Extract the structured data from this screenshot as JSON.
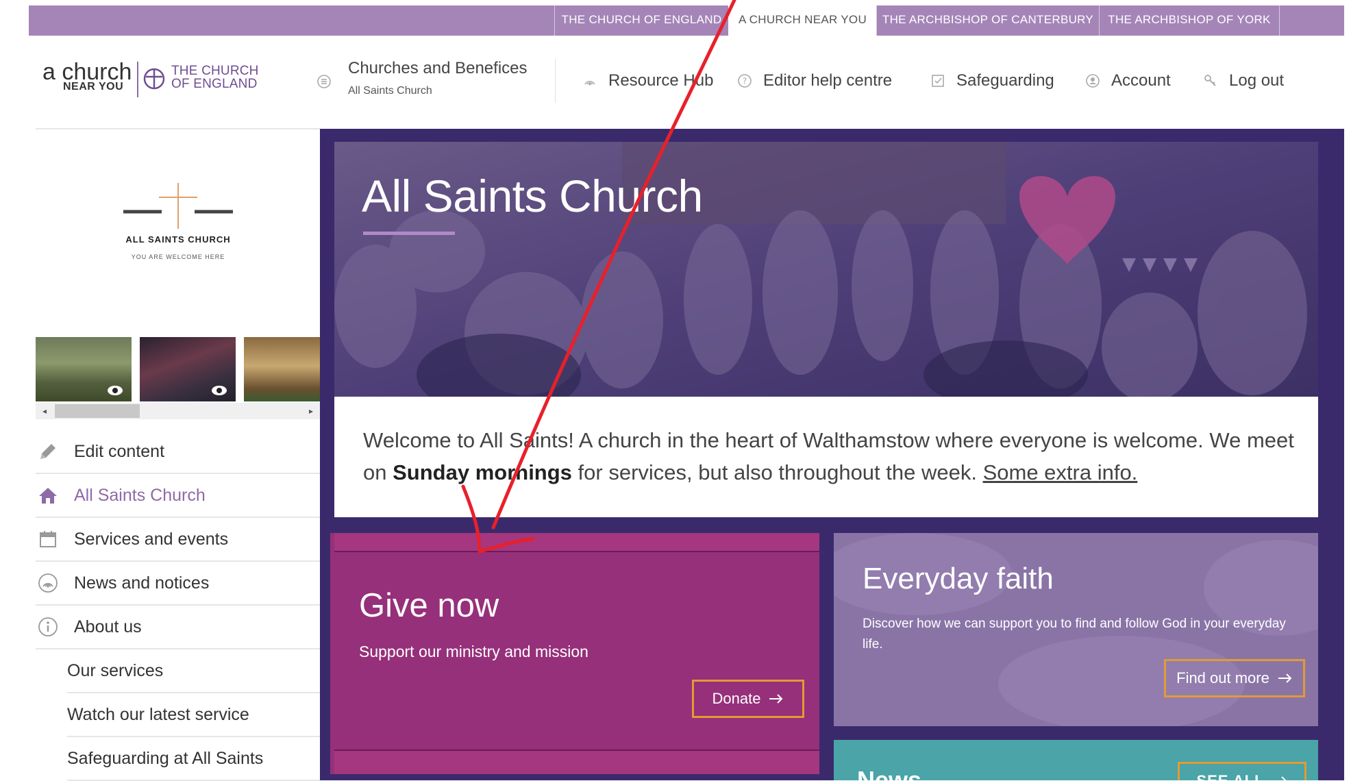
{
  "topbar": {
    "tabs": [
      {
        "label": "The Church of England",
        "active": false
      },
      {
        "label": "A Church Near You",
        "active": true
      },
      {
        "label": "The Archbishop of Canterbury",
        "active": false
      },
      {
        "label": "The Archbishop of York",
        "active": false
      }
    ]
  },
  "logo": {
    "brand_line1": "a church",
    "brand_line2": "NEAR YOU",
    "coe_line1": "THE CHURCH",
    "coe_line2": "OF ENGLAND"
  },
  "header": {
    "churches": {
      "label": "Churches and Benefices",
      "sub": "All Saints Church"
    },
    "nav": [
      {
        "label": "Resource Hub",
        "icon": "broadcast-icon"
      },
      {
        "label": "Editor help centre",
        "icon": "help-icon"
      },
      {
        "label": "Safeguarding",
        "icon": "checkbox-icon"
      },
      {
        "label": "Account",
        "icon": "user-icon"
      },
      {
        "label": "Log out",
        "icon": "key-icon"
      }
    ]
  },
  "sidebar": {
    "church_logo": {
      "name": "ALL SAINTS CHURCH",
      "tagline": "YOU ARE WELCOME HERE"
    },
    "items": [
      {
        "label": "Edit content",
        "icon": "pencil-icon",
        "active": false
      },
      {
        "label": "All Saints Church",
        "icon": "home-icon",
        "active": true
      },
      {
        "label": "Services and events",
        "icon": "calendar-icon",
        "active": false
      },
      {
        "label": "News and notices",
        "icon": "broadcast-icon",
        "active": false
      },
      {
        "label": "About us",
        "icon": "info-icon",
        "active": false
      }
    ],
    "sub_items": [
      {
        "label": "Our services"
      },
      {
        "label": "Watch our latest service"
      },
      {
        "label": "Safeguarding at All Saints"
      }
    ]
  },
  "hero": {
    "title": "All Saints Church"
  },
  "welcome": {
    "text_before": "Welcome to All Saints! A church in the heart of Walthamstow where everyone is welcome. We meet on ",
    "text_bold": "Sunday mornings",
    "text_after": " for services, but also throughout the week. ",
    "link": "Some extra info."
  },
  "give": {
    "title": "Give now",
    "subtitle": "Support our ministry and mission",
    "button": "Donate"
  },
  "faith": {
    "title": "Everyday faith",
    "description": "Discover how we can support you to find and follow God in your everyday life.",
    "button": "Find out more"
  },
  "news": {
    "title": "News",
    "button": "SEE ALL"
  },
  "colors": {
    "topbar": "#a585b8",
    "main_bg": "#3a2a6c",
    "give_bg": "#96307a",
    "faith_bg": "#8a74a6",
    "news_bg": "#4aa4a8",
    "accent_orange": "#e29b33",
    "annotation_red": "#e8202a"
  }
}
